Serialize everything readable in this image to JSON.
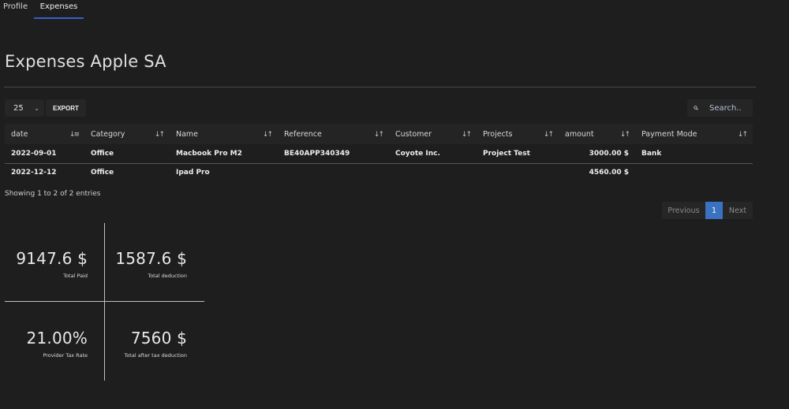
{
  "tabs": [
    {
      "label": "Profile",
      "active": false
    },
    {
      "label": "Expenses",
      "active": true
    }
  ],
  "page_title": "Expenses Apple SA",
  "toolbar": {
    "page_length": "25",
    "export_label": "EXPORT",
    "search_placeholder": "Search.."
  },
  "table": {
    "columns": [
      "date",
      "Category",
      "Name",
      "Reference",
      "Customer",
      "Projects",
      "amount",
      "Payment Mode"
    ],
    "sort_icons": {
      "active": "sort-ascending-icon",
      "default": "sort-icon"
    },
    "rows": [
      [
        "2022-09-01",
        "Office",
        "Macbook Pro M2",
        "BE40APP340349",
        "Coyote Inc.",
        "Project Test",
        "3000.00 $",
        "Bank"
      ],
      [
        "2022-12-12",
        "Office",
        "Ipad Pro",
        "",
        "",
        "",
        "4560.00 $",
        ""
      ]
    ]
  },
  "info_text": "Showing 1 to 2 of 2 entries",
  "pagination": {
    "previous": "Previous",
    "current": "1",
    "next": "Next",
    "accent": "#3a71c1"
  },
  "stats": [
    {
      "value": "9147.6 $",
      "label": "Total Paid"
    },
    {
      "value": "1587.6 $",
      "label": "Total deduction"
    },
    {
      "value": "21.00%",
      "label": "Provider Tax Rate"
    },
    {
      "value": "7560 $",
      "label": "Total after tax deduction"
    }
  ],
  "colors": {
    "background": "#1e1e1e",
    "tab_underline": "#3b5dc9",
    "header_row": "#242424"
  }
}
